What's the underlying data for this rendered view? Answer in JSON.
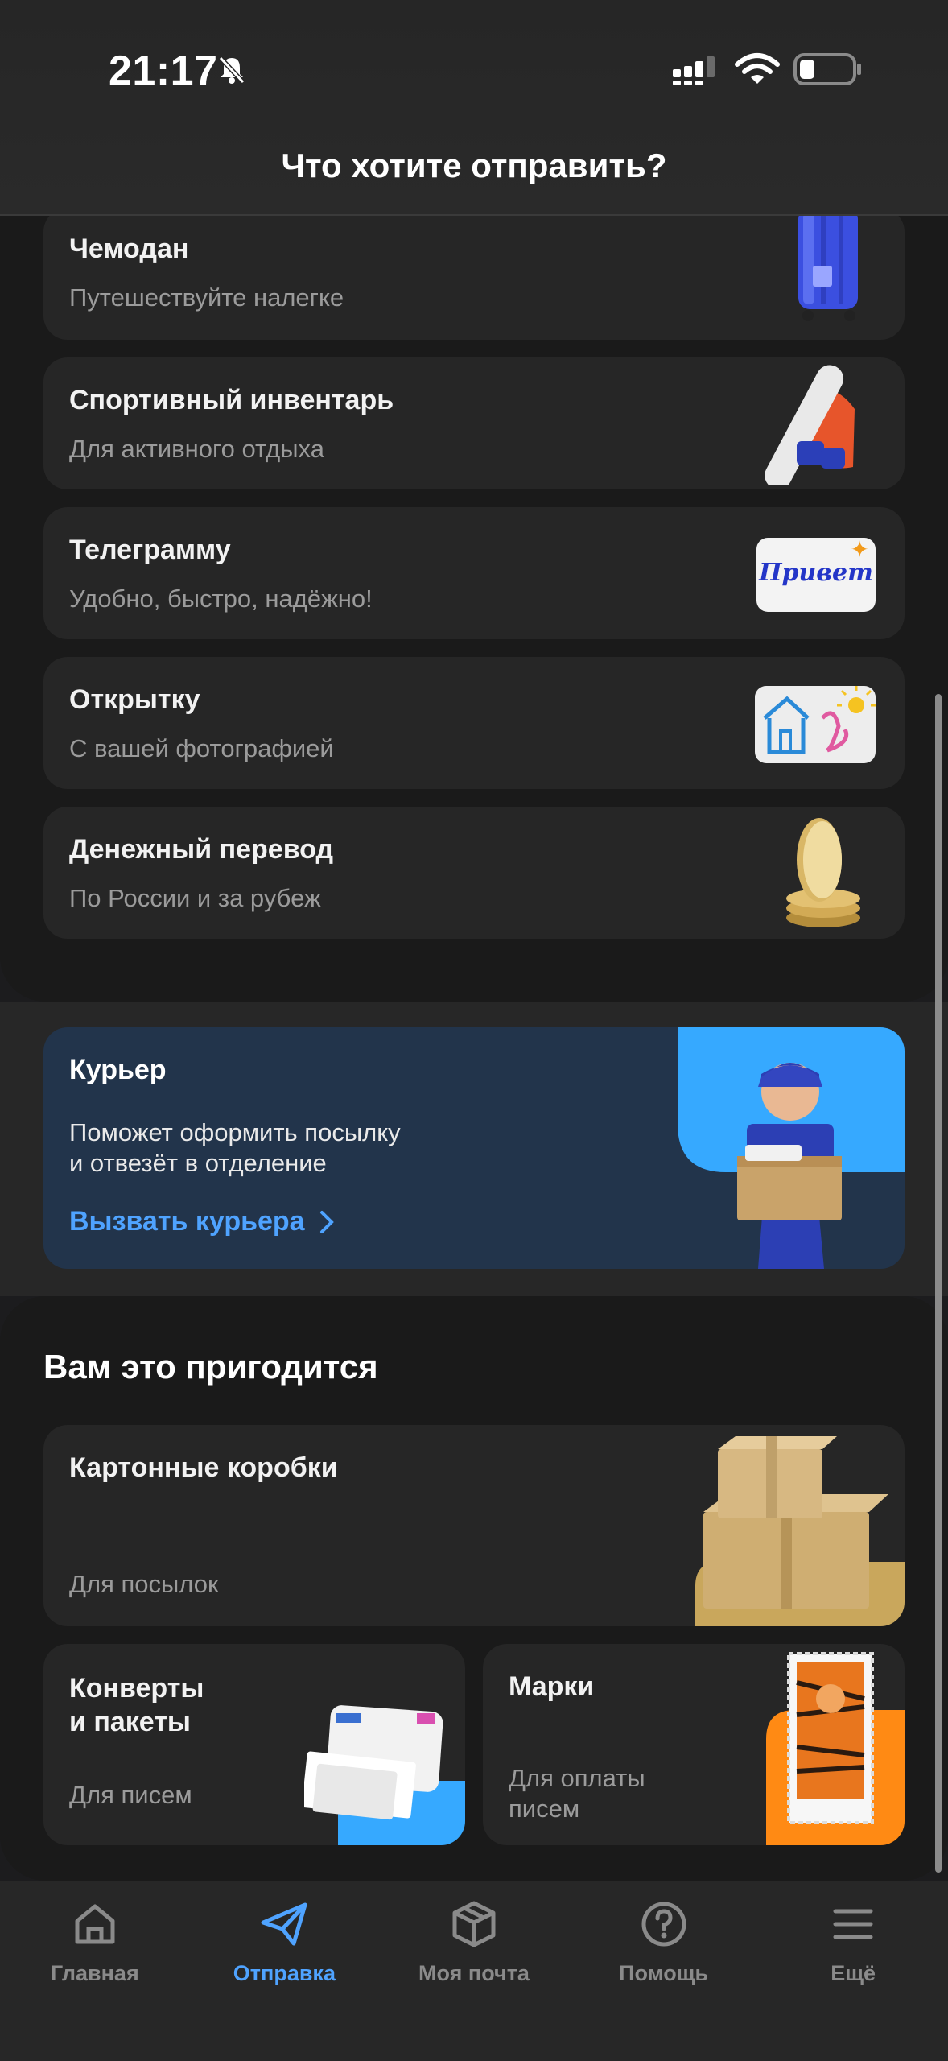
{
  "status": {
    "time": "21:17"
  },
  "header": {
    "title": "Что хотите отправить?"
  },
  "items": [
    {
      "title": "Чемодан",
      "subtitle": "Путешествуйте налегке"
    },
    {
      "title": "Спортивный инвентарь",
      "subtitle": "Для активного отдыха"
    },
    {
      "title": "Телеграмму",
      "subtitle": "Удобно, быстро, надёжно!"
    },
    {
      "title": "Открытку",
      "subtitle": "С вашей фотографией"
    },
    {
      "title": "Денежный перевод",
      "subtitle": "По России и за рубеж"
    }
  ],
  "telegram_thumb_text": "Привет",
  "courier": {
    "title": "Курьер",
    "line1": "Поможет оформить посылку",
    "line2": "и отвезёт в отделение",
    "link": "Вызвать курьера"
  },
  "useful": {
    "heading": "Вам это пригодится",
    "boxes": {
      "title": "Картонные коробки",
      "subtitle": "Для посылок"
    },
    "envelopes": {
      "title_line1": "Конверты",
      "title_line2": "и пакеты",
      "subtitle": "Для писем"
    },
    "stamps": {
      "title": "Марки",
      "subtitle_line1": "Для оплаты",
      "subtitle_line2": "писем"
    }
  },
  "nav": [
    {
      "label": "Главная",
      "icon": "home-icon"
    },
    {
      "label": "Отправка",
      "icon": "send-icon",
      "active": true
    },
    {
      "label": "Моя почта",
      "icon": "package-icon"
    },
    {
      "label": "Помощь",
      "icon": "help-icon"
    },
    {
      "label": "Ещё",
      "icon": "menu-icon"
    }
  ],
  "colors": {
    "accent": "#4fa3ff",
    "background": "#1c1c1e",
    "card": "#262626",
    "courier_card": "#22344b"
  }
}
